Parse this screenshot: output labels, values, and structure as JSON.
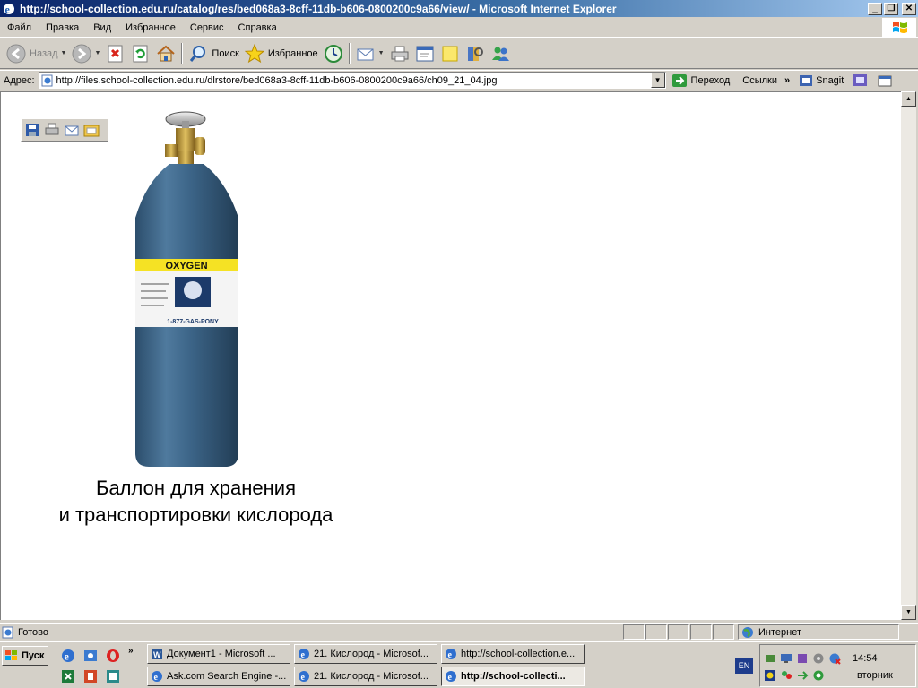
{
  "window": {
    "title": "http://school-collection.edu.ru/catalog/res/bed068a3-8cff-11db-b606-0800200c9a66/view/ - Microsoft Internet Explorer"
  },
  "menu": [
    "Файл",
    "Правка",
    "Вид",
    "Избранное",
    "Сервис",
    "Справка"
  ],
  "toolbar": {
    "back_label": "Назад",
    "search_label": "Поиск",
    "favorites_label": "Избранное"
  },
  "address": {
    "label": "Адрес:",
    "url": "http://files.school-collection.edu.ru/dlrstore/bed068a3-8cff-11db-b606-0800200c9a66/ch09_21_04.jpg",
    "go_label": "Переход",
    "links_label": "Ссылки",
    "snagit_label": "Snagit"
  },
  "content": {
    "cylinder_label": "OXYGEN",
    "cylinder_slogan": "1-877-GAS-PONY",
    "caption_line1": "Баллон для хранения",
    "caption_line2": "и транспортировки кислорода"
  },
  "status": {
    "text": "Готово",
    "zone": "Интернет"
  },
  "taskbar": {
    "start_label": "Пуск",
    "tasks": [
      {
        "label": "Документ1 - Microsoft ..."
      },
      {
        "label": "21. Кислород - Microsof..."
      },
      {
        "label": "http://school-collection.e..."
      },
      {
        "label": "Ask.com Search Engine -..."
      },
      {
        "label": "21. Кислород - Microsof..."
      },
      {
        "label": "http://school-collecti..."
      }
    ],
    "lang": "EN",
    "time": "14:54",
    "day": "вторник"
  }
}
